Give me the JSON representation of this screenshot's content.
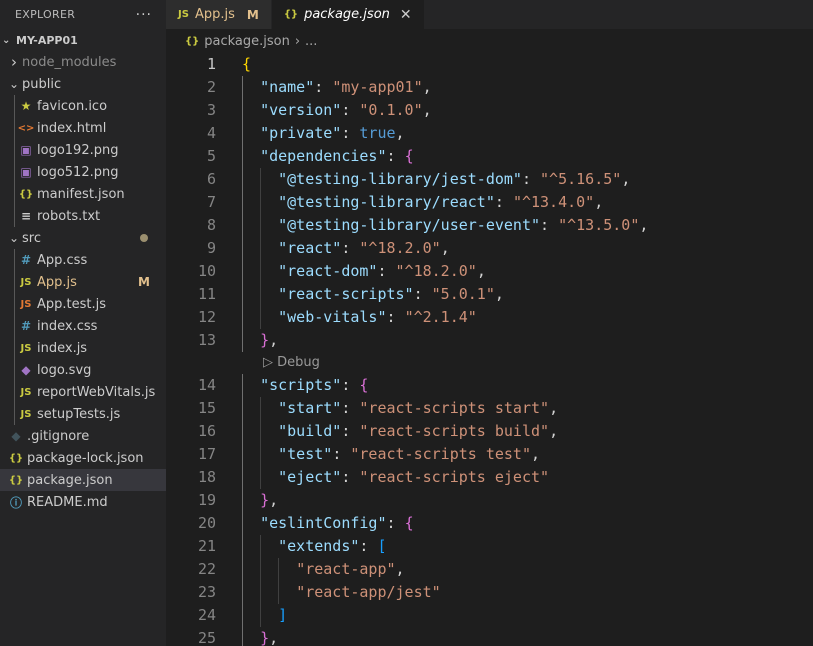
{
  "explorer": {
    "title": "EXPLORER",
    "more_label": "···",
    "project": "MY-APP01",
    "items": [
      {
        "label": "node_modules",
        "type": "folder",
        "expanded": false,
        "depth": 0,
        "color": "#8b8b8b"
      },
      {
        "label": "public",
        "type": "folder",
        "expanded": true,
        "depth": 0,
        "color": "#cccccc"
      },
      {
        "label": "favicon.ico",
        "type": "file",
        "depth": 1,
        "icon": "star-icon",
        "glyph": "★",
        "icon_color": "#cbcb41",
        "color": "#cccccc"
      },
      {
        "label": "index.html",
        "type": "file",
        "depth": 1,
        "icon": "html-icon",
        "glyph": "<>",
        "icon_color": "#e37933",
        "color": "#cccccc"
      },
      {
        "label": "logo192.png",
        "type": "file",
        "depth": 1,
        "icon": "image-icon",
        "glyph": "▣",
        "icon_color": "#a074c4",
        "color": "#cccccc"
      },
      {
        "label": "logo512.png",
        "type": "file",
        "depth": 1,
        "icon": "image-icon",
        "glyph": "▣",
        "icon_color": "#a074c4",
        "color": "#cccccc"
      },
      {
        "label": "manifest.json",
        "type": "file",
        "depth": 1,
        "icon": "json-icon",
        "glyph": "{}",
        "icon_color": "#cbcb41",
        "color": "#cccccc"
      },
      {
        "label": "robots.txt",
        "type": "file",
        "depth": 1,
        "icon": "text-icon",
        "glyph": "≡",
        "icon_color": "#cccccc",
        "color": "#cccccc"
      },
      {
        "label": "src",
        "type": "folder",
        "expanded": true,
        "depth": 0,
        "color": "#cccccc",
        "dot": true
      },
      {
        "label": "App.css",
        "type": "file",
        "depth": 1,
        "icon": "css-icon",
        "glyph": "#",
        "icon_color": "#519aba",
        "color": "#cccccc"
      },
      {
        "label": "App.js",
        "type": "file",
        "depth": 1,
        "icon": "js-icon",
        "glyph": "JS",
        "icon_color": "#cbcb41",
        "color": "#e2c08d",
        "badge": "M"
      },
      {
        "label": "App.test.js",
        "type": "file",
        "depth": 1,
        "icon": "js-icon",
        "glyph": "JS",
        "icon_color": "#e37933",
        "color": "#cccccc"
      },
      {
        "label": "index.css",
        "type": "file",
        "depth": 1,
        "icon": "css-icon",
        "glyph": "#",
        "icon_color": "#519aba",
        "color": "#cccccc"
      },
      {
        "label": "index.js",
        "type": "file",
        "depth": 1,
        "icon": "js-icon",
        "glyph": "JS",
        "icon_color": "#cbcb41",
        "color": "#cccccc"
      },
      {
        "label": "logo.svg",
        "type": "file",
        "depth": 1,
        "icon": "svg-icon",
        "glyph": "◆",
        "icon_color": "#a074c4",
        "color": "#cccccc"
      },
      {
        "label": "reportWebVitals.js",
        "type": "file",
        "depth": 1,
        "icon": "js-icon",
        "glyph": "JS",
        "icon_color": "#cbcb41",
        "color": "#cccccc"
      },
      {
        "label": "setupTests.js",
        "type": "file",
        "depth": 1,
        "icon": "js-icon",
        "glyph": "JS",
        "icon_color": "#cbcb41",
        "color": "#cccccc"
      },
      {
        "label": ".gitignore",
        "type": "file",
        "depth": 0,
        "icon": "git-icon",
        "glyph": "◆",
        "icon_color": "#41535b",
        "color": "#cccccc"
      },
      {
        "label": "package-lock.json",
        "type": "file",
        "depth": 0,
        "icon": "json-icon",
        "glyph": "{}",
        "icon_color": "#cbcb41",
        "color": "#cccccc"
      },
      {
        "label": "package.json",
        "type": "file",
        "depth": 0,
        "icon": "json-icon",
        "glyph": "{}",
        "icon_color": "#cbcb41",
        "color": "#cccccc",
        "selected": true
      },
      {
        "label": "README.md",
        "type": "file",
        "depth": 0,
        "icon": "info-icon",
        "glyph": "ⓘ",
        "icon_color": "#519aba",
        "color": "#cccccc"
      }
    ]
  },
  "tabs": [
    {
      "label": "App.js",
      "icon": "js-icon",
      "glyph": "JS",
      "icon_color": "#cbcb41",
      "label_color": "#e2c08d",
      "mark": "M",
      "active": false
    },
    {
      "label": "package.json",
      "icon": "json-icon",
      "glyph": "{}",
      "icon_color": "#cbcb41",
      "close": "✕",
      "active": true
    }
  ],
  "breadcrumb": {
    "icon": "json-icon",
    "glyph": "{}",
    "file": "package.json",
    "separator": "›",
    "rest": "..."
  },
  "editor": {
    "codelens_label": "Debug",
    "codelens_glyph": "▷",
    "lines": [
      {
        "n": "1",
        "tokens": [
          [
            "br1",
            "{"
          ]
        ]
      },
      {
        "n": "2",
        "tokens": [
          [
            "ind",
            "  "
          ],
          [
            "k",
            "\"name\""
          ],
          [
            "p",
            ": "
          ],
          [
            "s",
            "\"my-app01\""
          ],
          [
            "p",
            ","
          ]
        ]
      },
      {
        "n": "3",
        "tokens": [
          [
            "ind",
            "  "
          ],
          [
            "k",
            "\"version\""
          ],
          [
            "p",
            ": "
          ],
          [
            "s",
            "\"0.1.0\""
          ],
          [
            "p",
            ","
          ]
        ]
      },
      {
        "n": "4",
        "tokens": [
          [
            "ind",
            "  "
          ],
          [
            "k",
            "\"private\""
          ],
          [
            "p",
            ": "
          ],
          [
            "b",
            "true"
          ],
          [
            "p",
            ","
          ]
        ]
      },
      {
        "n": "5",
        "tokens": [
          [
            "ind",
            "  "
          ],
          [
            "k",
            "\"dependencies\""
          ],
          [
            "p",
            ": "
          ],
          [
            "br2",
            "{"
          ]
        ]
      },
      {
        "n": "6",
        "tokens": [
          [
            "ind",
            "    "
          ],
          [
            "k",
            "\"@testing-library/jest-dom\""
          ],
          [
            "p",
            ": "
          ],
          [
            "s",
            "\"^5.16.5\""
          ],
          [
            "p",
            ","
          ]
        ]
      },
      {
        "n": "7",
        "tokens": [
          [
            "ind",
            "    "
          ],
          [
            "k",
            "\"@testing-library/react\""
          ],
          [
            "p",
            ": "
          ],
          [
            "s",
            "\"^13.4.0\""
          ],
          [
            "p",
            ","
          ]
        ]
      },
      {
        "n": "8",
        "tokens": [
          [
            "ind",
            "    "
          ],
          [
            "k",
            "\"@testing-library/user-event\""
          ],
          [
            "p",
            ": "
          ],
          [
            "s",
            "\"^13.5.0\""
          ],
          [
            "p",
            ","
          ]
        ]
      },
      {
        "n": "9",
        "tokens": [
          [
            "ind",
            "    "
          ],
          [
            "k",
            "\"react\""
          ],
          [
            "p",
            ": "
          ],
          [
            "s",
            "\"^18.2.0\""
          ],
          [
            "p",
            ","
          ]
        ]
      },
      {
        "n": "10",
        "tokens": [
          [
            "ind",
            "    "
          ],
          [
            "k",
            "\"react-dom\""
          ],
          [
            "p",
            ": "
          ],
          [
            "s",
            "\"^18.2.0\""
          ],
          [
            "p",
            ","
          ]
        ]
      },
      {
        "n": "11",
        "tokens": [
          [
            "ind",
            "    "
          ],
          [
            "k",
            "\"react-scripts\""
          ],
          [
            "p",
            ": "
          ],
          [
            "s",
            "\"5.0.1\""
          ],
          [
            "p",
            ","
          ]
        ]
      },
      {
        "n": "12",
        "tokens": [
          [
            "ind",
            "    "
          ],
          [
            "k",
            "\"web-vitals\""
          ],
          [
            "p",
            ": "
          ],
          [
            "s",
            "\"^2.1.4\""
          ]
        ]
      },
      {
        "n": "13",
        "tokens": [
          [
            "ind",
            "  "
          ],
          [
            "br2",
            "}"
          ],
          [
            "p",
            ","
          ]
        ],
        "lens_after": true
      },
      {
        "n": "14",
        "tokens": [
          [
            "ind",
            "  "
          ],
          [
            "k",
            "\"scripts\""
          ],
          [
            "p",
            ": "
          ],
          [
            "br2",
            "{"
          ]
        ]
      },
      {
        "n": "15",
        "tokens": [
          [
            "ind",
            "    "
          ],
          [
            "k",
            "\"start\""
          ],
          [
            "p",
            ": "
          ],
          [
            "s",
            "\"react-scripts start\""
          ],
          [
            "p",
            ","
          ]
        ]
      },
      {
        "n": "16",
        "tokens": [
          [
            "ind",
            "    "
          ],
          [
            "k",
            "\"build\""
          ],
          [
            "p",
            ": "
          ],
          [
            "s",
            "\"react-scripts build\""
          ],
          [
            "p",
            ","
          ]
        ]
      },
      {
        "n": "17",
        "tokens": [
          [
            "ind",
            "    "
          ],
          [
            "k",
            "\"test\""
          ],
          [
            "p",
            ": "
          ],
          [
            "s",
            "\"react-scripts test\""
          ],
          [
            "p",
            ","
          ]
        ]
      },
      {
        "n": "18",
        "tokens": [
          [
            "ind",
            "    "
          ],
          [
            "k",
            "\"eject\""
          ],
          [
            "p",
            ": "
          ],
          [
            "s",
            "\"react-scripts eject\""
          ]
        ]
      },
      {
        "n": "19",
        "tokens": [
          [
            "ind",
            "  "
          ],
          [
            "br2",
            "}"
          ],
          [
            "p",
            ","
          ]
        ]
      },
      {
        "n": "20",
        "tokens": [
          [
            "ind",
            "  "
          ],
          [
            "k",
            "\"eslintConfig\""
          ],
          [
            "p",
            ": "
          ],
          [
            "br2",
            "{"
          ]
        ]
      },
      {
        "n": "21",
        "tokens": [
          [
            "ind",
            "    "
          ],
          [
            "k",
            "\"extends\""
          ],
          [
            "p",
            ": "
          ],
          [
            "br3",
            "["
          ]
        ]
      },
      {
        "n": "22",
        "tokens": [
          [
            "ind",
            "      "
          ],
          [
            "s",
            "\"react-app\""
          ],
          [
            "p",
            ","
          ]
        ]
      },
      {
        "n": "23",
        "tokens": [
          [
            "ind",
            "      "
          ],
          [
            "s",
            "\"react-app/jest\""
          ]
        ]
      },
      {
        "n": "24",
        "tokens": [
          [
            "ind",
            "    "
          ],
          [
            "br3",
            "]"
          ]
        ]
      },
      {
        "n": "25",
        "tokens": [
          [
            "ind",
            "  "
          ],
          [
            "br2",
            "}"
          ],
          [
            "p",
            ","
          ]
        ]
      }
    ]
  }
}
